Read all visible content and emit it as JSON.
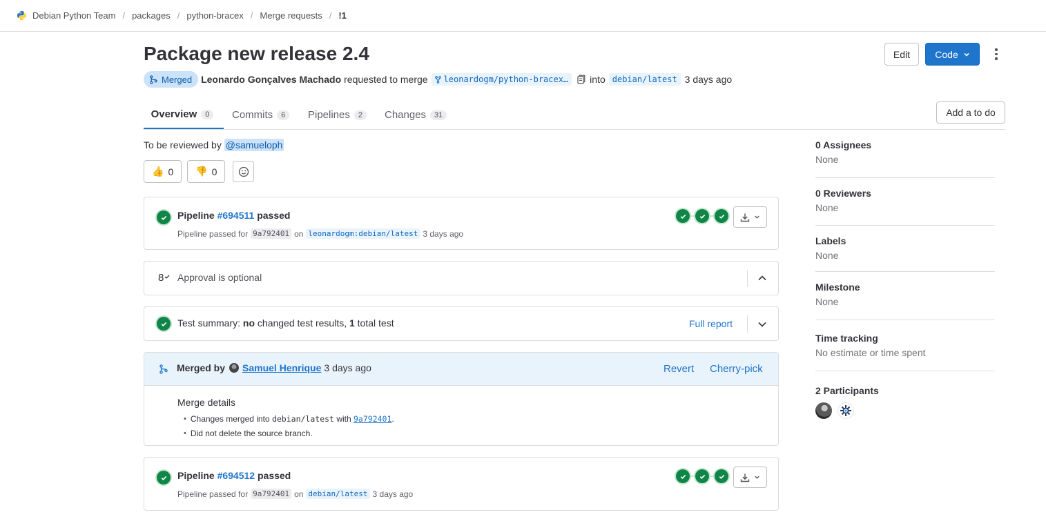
{
  "breadcrumb": {
    "items": [
      "Debian Python Team",
      "packages",
      "python-bracex",
      "Merge requests",
      "!1"
    ]
  },
  "header": {
    "title": "Package new release 2.4",
    "edit_label": "Edit",
    "code_label": "Code",
    "status_badge": "Merged",
    "author": "Leonardo Gonçalves Machado",
    "requested_text": "requested to merge",
    "source_branch": "leonardogm/python-bracex…",
    "into_text": "into",
    "target_branch": "debian/latest",
    "time_ago": "3 days ago"
  },
  "tabs": [
    {
      "label": "Overview",
      "count": "0"
    },
    {
      "label": "Commits",
      "count": "6"
    },
    {
      "label": "Pipelines",
      "count": "2"
    },
    {
      "label": "Changes",
      "count": "31"
    }
  ],
  "todo_label": "Add a to do",
  "review": {
    "text": "To be reviewed by",
    "reviewer": "@samueloph"
  },
  "reactions": {
    "thumbsup_emoji": "👍",
    "thumbsup_count": "0",
    "thumbsdown_emoji": "👎",
    "thumbsdown_count": "0"
  },
  "pipeline1": {
    "prefix": "Pipeline",
    "id": "#694511",
    "status": "passed",
    "sub_prefix": "Pipeline passed for",
    "sha": "9a792401",
    "on": "on",
    "ref": "leonardogm:debian/latest",
    "time": "3 days ago"
  },
  "approval": {
    "icon_text": "8",
    "text": "Approval is optional"
  },
  "test_summary": {
    "prefix": "Test summary:",
    "no": "no",
    "middle": "changed test results,",
    "total": "1",
    "suffix": "total test",
    "full_report": "Full report"
  },
  "merged": {
    "prefix": "Merged by",
    "user": "Samuel Henrique",
    "time": "3 days ago",
    "revert": "Revert",
    "cherry_pick": "Cherry-pick",
    "details_title": "Merge details",
    "line1_prefix": "Changes merged into",
    "line1_branch": "debian/latest",
    "line1_with": "with",
    "line1_sha": "9a792401",
    "line1_end": ".",
    "line2": "Did not delete the source branch."
  },
  "pipeline2": {
    "prefix": "Pipeline",
    "id": "#694512",
    "status": "passed",
    "sub_prefix": "Pipeline passed for",
    "sha": "9a792401",
    "on": "on",
    "ref": "debian/latest",
    "time": "3 days ago"
  },
  "sidebar": {
    "assignees_label": "0 Assignees",
    "assignees_value": "None",
    "reviewers_label": "0 Reviewers",
    "reviewers_value": "None",
    "labels_label": "Labels",
    "labels_value": "None",
    "milestone_label": "Milestone",
    "milestone_value": "None",
    "time_label": "Time tracking",
    "time_value": "No estimate or time spent",
    "participants_label": "2 Participants"
  },
  "colors": {
    "accent": "#1f75cb",
    "success": "#108548",
    "merged_bg": "#cbe2f9"
  }
}
